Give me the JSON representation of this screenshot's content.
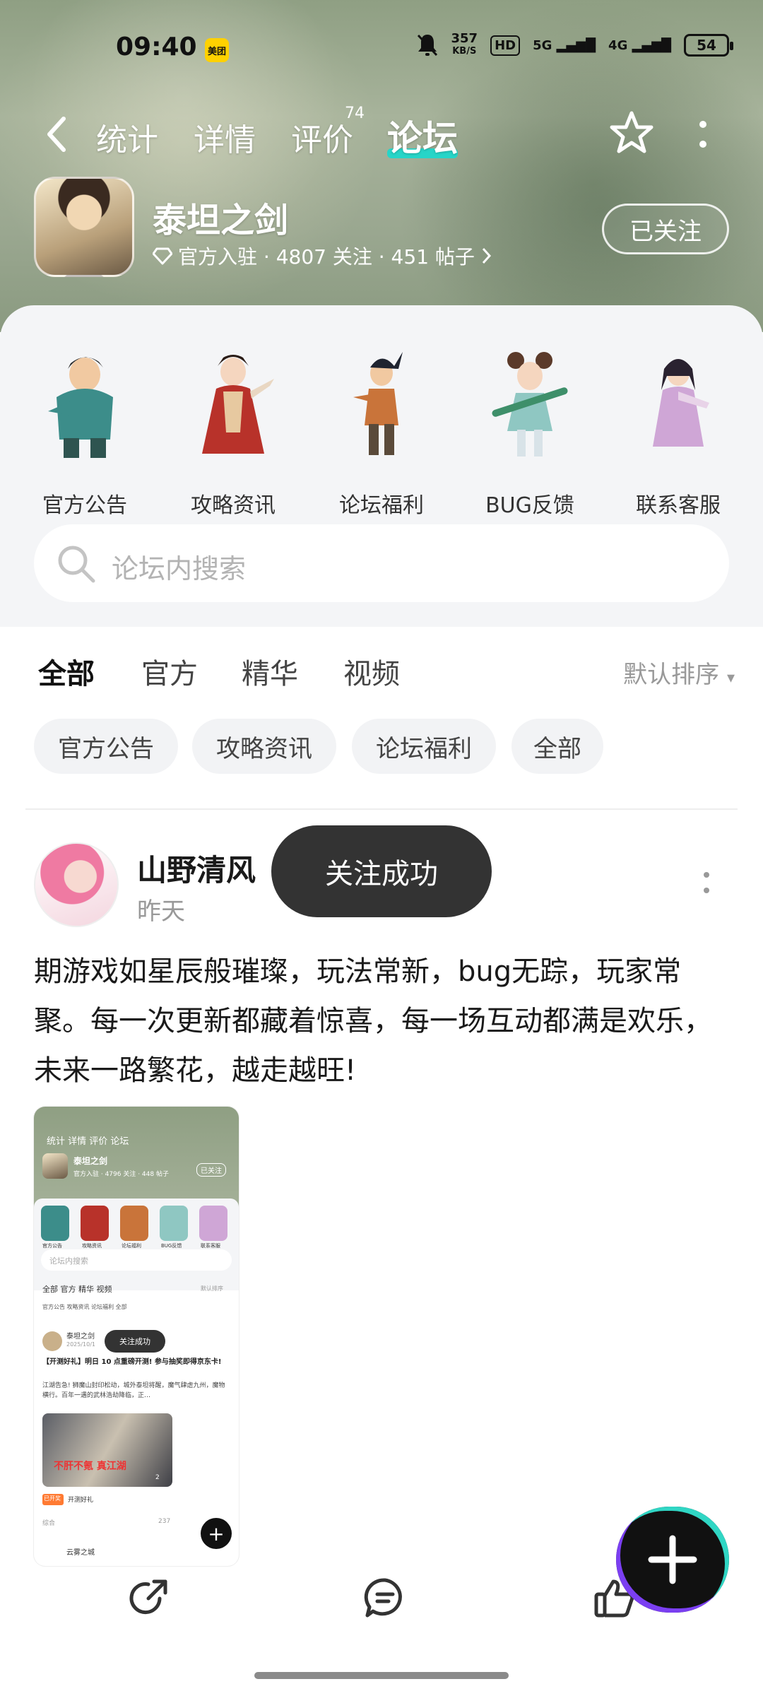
{
  "status_bar": {
    "time": "09:40",
    "meituan_badge": "美团",
    "net_speed_value": "357",
    "net_speed_unit": "KB/S",
    "hd": "HD",
    "signal_5g": "5G",
    "signal_4g": "4G",
    "battery": "54"
  },
  "nav": {
    "tabs": [
      {
        "label": "统计"
      },
      {
        "label": "详情"
      },
      {
        "label": "评价",
        "badge": "74"
      },
      {
        "label": "论坛",
        "active": true
      }
    ]
  },
  "app": {
    "name": "泰坦之剑",
    "meta": "官方入驻 · 4807 关注 · 451 帖子",
    "follow_label": "已关注"
  },
  "shortcuts": [
    {
      "label": "官方公告"
    },
    {
      "label": "攻略资讯"
    },
    {
      "label": "论坛福利"
    },
    {
      "label": "BUG反馈"
    },
    {
      "label": "联系客服"
    }
  ],
  "search": {
    "placeholder": "论坛内搜索"
  },
  "filter_tabs": [
    {
      "label": "全部",
      "active": true
    },
    {
      "label": "官方"
    },
    {
      "label": "精华"
    },
    {
      "label": "视频"
    }
  ],
  "sort_label": "默认排序",
  "chips": [
    {
      "label": "官方公告"
    },
    {
      "label": "攻略资讯"
    },
    {
      "label": "论坛福利"
    },
    {
      "label": "全部"
    }
  ],
  "post": {
    "author": "山野清风",
    "time": "昨天",
    "body": "期游戏如星辰般璀璨，玩法常新，bug无踪，玩家常聚。每一次更新都藏着惊喜，每一场互动都满是欢乐，未来一路繁花，越走越旺!"
  },
  "toast": "关注成功",
  "thumbnail": {
    "tabs": "统计  详情  评价  论坛",
    "app_name": "泰坦之剑",
    "meta": "官方入驻 · 4796 关注 · 448 帖子",
    "follow": "已关注",
    "shortcuts": [
      "官方公告",
      "攻略资讯",
      "论坛福利",
      "BUG反馈",
      "联系客服"
    ],
    "search": "论坛内搜索",
    "filter_tabs": "全部  官方  精华  视频",
    "sort": "默认排序",
    "chips": "官方公告  攻略资讯  论坛福利  全部",
    "post_author": "泰坦之剑",
    "post_date": "2025/10/1",
    "toast": "关注成功",
    "post_title": "【开测好礼】明日 10 点重磅开测! 参与抽奖即得京东卡!",
    "post_body": "江湖告急! 狮魔山封印松动，城外泰坦将醒，魔气肆虐九州，魔物横行。百年一遇的武林浩劫降临，正…",
    "image_caption": "不肝不氪 真江湖",
    "image_count": "2",
    "tag": "已开奖",
    "tag_text": "开测好礼",
    "category": "综合",
    "comment_count": "237",
    "next_author": "云雾之城"
  },
  "colors": {
    "accent": "#27d5c8",
    "toast_bg": "#333333",
    "panel_bg": "#f4f5f7"
  }
}
